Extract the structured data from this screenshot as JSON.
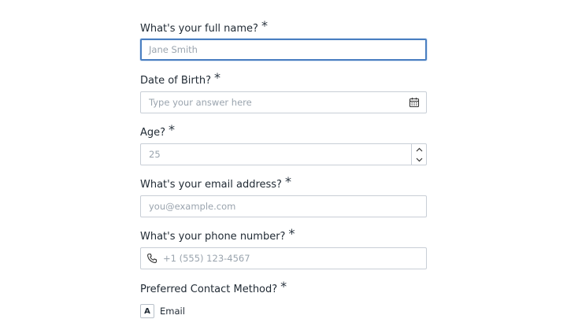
{
  "fields": [
    {
      "label": "What's your full name?",
      "required": "*",
      "placeholder": "Jane Smith",
      "state": "focused"
    },
    {
      "label": "Date of Birth?",
      "required": "*",
      "placeholder": "Type your answer here",
      "icon": "calendar-icon"
    },
    {
      "label": "Age?",
      "required": "*",
      "placeholder": "25",
      "icons": [
        "chevron-up-icon",
        "chevron-down-icon"
      ]
    },
    {
      "label": "What's your email address?",
      "required": "*",
      "placeholder": "you@example.com"
    },
    {
      "label": "What's your phone number?",
      "required": "*",
      "placeholder": "+1 (555) 123-4567",
      "icon": "phone-icon"
    },
    {
      "label": "Preferred Contact Method?",
      "required": "*"
    }
  ],
  "contact_options": [
    {
      "key": "A",
      "label": "Email"
    }
  ],
  "colors": {
    "focus_border": "#4a7fc1",
    "input_border": "#c8ced6",
    "placeholder": "#9aa4ae",
    "label": "#1f2933"
  }
}
